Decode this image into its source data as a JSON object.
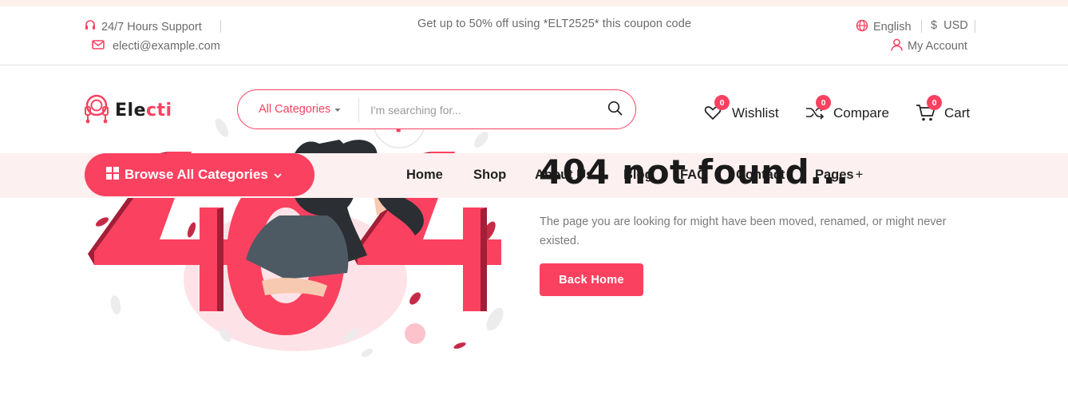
{
  "topbar": {
    "support": "24/7 Hours Support",
    "email": "electi@example.com",
    "promo": "Get up to 50% off using *ELT2525* this coupon code",
    "language": "English",
    "currency": "$  USD",
    "account": "My Account"
  },
  "header": {
    "logo_main": "Ele",
    "logo_accent": "cti",
    "search": {
      "category": "All Categories",
      "placeholder": "I'm searching for..."
    },
    "wishlist": {
      "label": "Wishlist",
      "count": "0"
    },
    "compare": {
      "label": "Compare",
      "count": "0"
    },
    "cart": {
      "label": "Cart",
      "count": "0"
    }
  },
  "nav": {
    "browse": "Browse All Categories",
    "items": [
      {
        "label": "Home"
      },
      {
        "label": "Shop"
      },
      {
        "label": "About Us"
      },
      {
        "label": "Blog"
      },
      {
        "label": "FAQ"
      },
      {
        "label": "Contact"
      },
      {
        "label": "Pages"
      }
    ],
    "pages_suffix": "+"
  },
  "content": {
    "title": "404 not found...",
    "description": "The page you are looking for might have been moved, renamed, or might never existed.",
    "button": "Back Home"
  },
  "colors": {
    "accent": "#fb4160",
    "nav_band": "#fdf0f0",
    "text_dark": "#1e1e1e",
    "text_muted": "#7a7a7a"
  }
}
